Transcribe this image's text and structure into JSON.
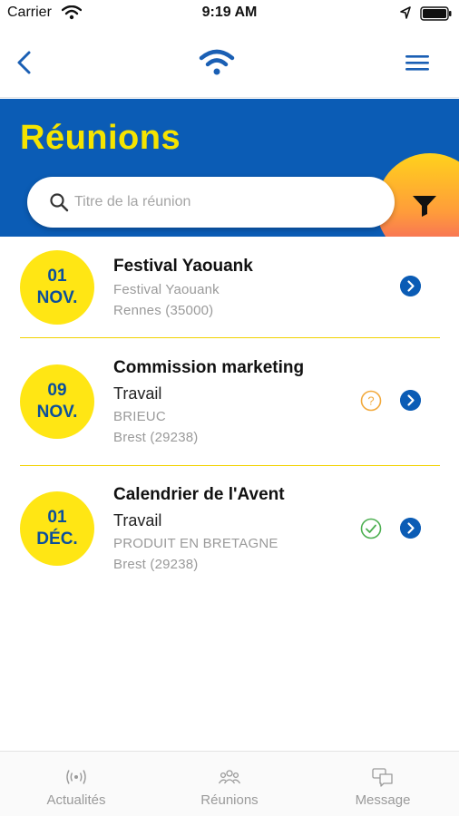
{
  "status_bar": {
    "carrier": "Carrier",
    "time": "9:19 AM",
    "icons": [
      "wifi-icon",
      "location-arrow-icon",
      "battery-icon"
    ]
  },
  "nav": {
    "back_icon": "chevron-left-icon",
    "logo_icon": "wifi-logo-icon",
    "menu_icon": "hamburger-menu-icon"
  },
  "header": {
    "title": "Réunions",
    "search_placeholder": "Titre de la réunion",
    "search_value": "",
    "filter_icon": "filter-funnel-icon"
  },
  "colors": {
    "brand_blue": "#0b5cb5",
    "brand_yellow": "#ffe614",
    "title_yellow": "#f5e400",
    "pending_orange": "#f2a93b",
    "confirmed_green": "#4caf50"
  },
  "meetings": [
    {
      "day": "01",
      "month": "NOV.",
      "title": "Festival Yaouank",
      "type": "",
      "organizer": "Festival Yaouank",
      "location": "Rennes (35000)",
      "status": "none"
    },
    {
      "day": "09",
      "month": "NOV.",
      "title": "Commission marketing",
      "type": "Travail",
      "organizer": "BRIEUC",
      "location": "Brest (29238)",
      "status": "pending"
    },
    {
      "day": "01",
      "month": "DÉC.",
      "title": "Calendrier de l'Avent",
      "type": "Travail",
      "organizer": "PRODUIT EN BRETAGNE",
      "location": "Brest (29238)",
      "status": "confirmed"
    }
  ],
  "tabs": [
    {
      "label": "Actualités",
      "icon": "broadcast-icon"
    },
    {
      "label": "Réunions",
      "icon": "people-group-icon"
    },
    {
      "label": "Message",
      "icon": "chat-bubbles-icon"
    }
  ]
}
